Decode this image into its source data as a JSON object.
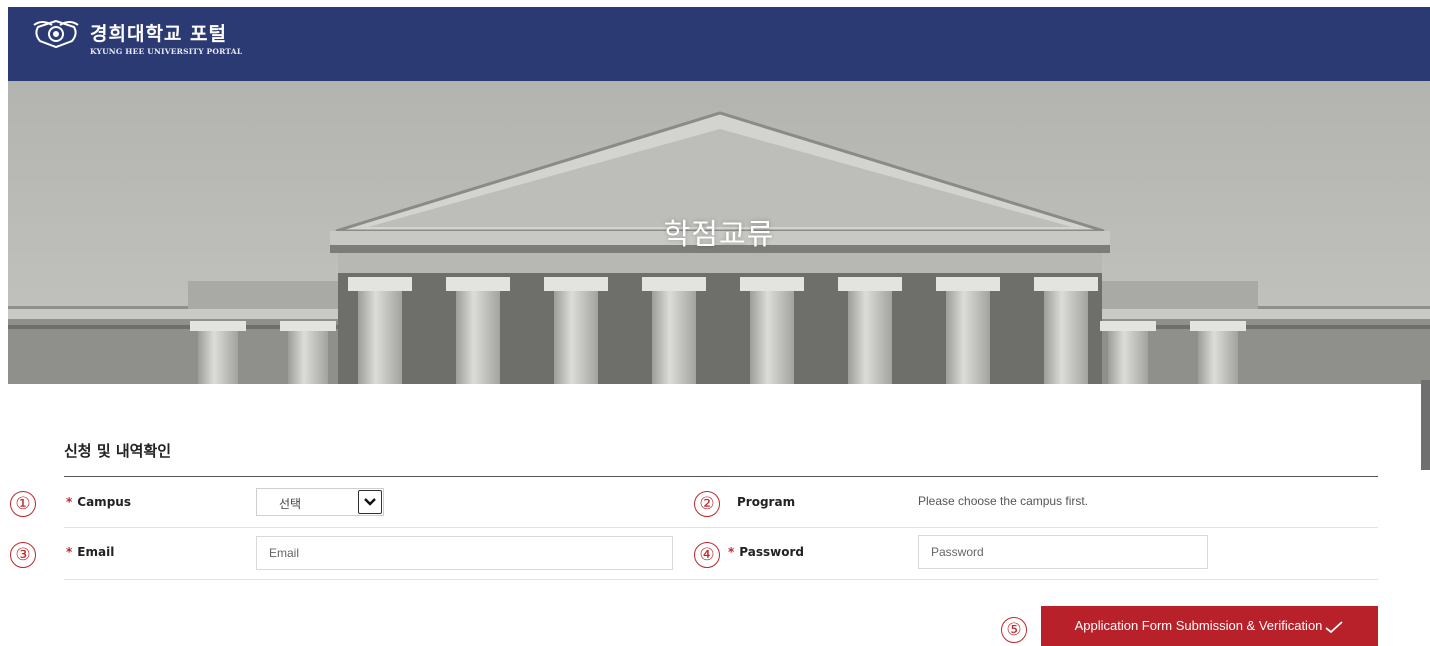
{
  "header": {
    "title_ko": "경희대학교 포털",
    "title_en": "KYUNG HEE UNIVERSITY PORTAL",
    "logo_icon": "university-emblem-icon",
    "background": "#2c3a73"
  },
  "hero": {
    "title": "학점교류"
  },
  "form": {
    "section_title": "신청 및 내역확인",
    "campus": {
      "number": "①",
      "required_mark": "*",
      "label": "Campus",
      "selected": "선택"
    },
    "program": {
      "number": "②",
      "label": "Program",
      "help": "Please choose the campus first."
    },
    "email": {
      "number": "③",
      "required_mark": "*",
      "label": "Email",
      "placeholder": "Email"
    },
    "password": {
      "number": "④",
      "required_mark": "*",
      "label": "Password",
      "placeholder": "Password"
    },
    "submit": {
      "number": "⑤",
      "label": "Application Form Submission & Verification"
    }
  },
  "colors": {
    "accent_red": "#b8202a",
    "annotation_red": "#c0272d"
  }
}
